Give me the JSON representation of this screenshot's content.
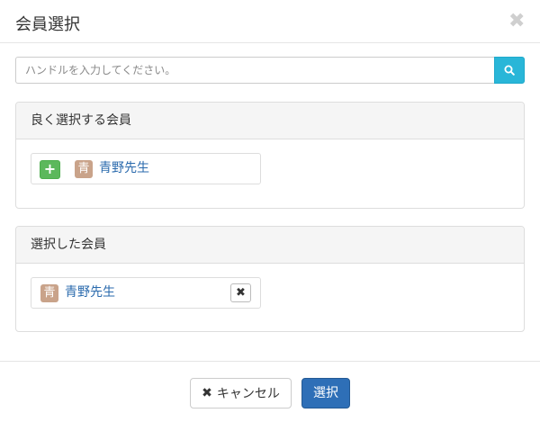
{
  "modal": {
    "title": "会員選択",
    "close_glyph": "✖"
  },
  "search": {
    "placeholder": "ハンドルを入力してください。",
    "value": "",
    "button_icon": "search-icon"
  },
  "frequent_members": {
    "heading": "良く選択する会員",
    "items": [
      {
        "avatar_char": "青",
        "name": "青野先生",
        "action_glyph": "+"
      }
    ]
  },
  "selected_members": {
    "heading": "選択した会員",
    "items": [
      {
        "avatar_char": "青",
        "name": "青野先生",
        "remove_glyph": "✖"
      }
    ]
  },
  "footer": {
    "cancel_glyph": "✖",
    "cancel_label": "キャンセル",
    "select_label": "選択"
  },
  "colors": {
    "search_button": "#29b6d8",
    "add_button": "#5cb85c",
    "avatar": "#c9a38a",
    "primary_button": "#2e6fb7",
    "link": "#2a6aad"
  }
}
